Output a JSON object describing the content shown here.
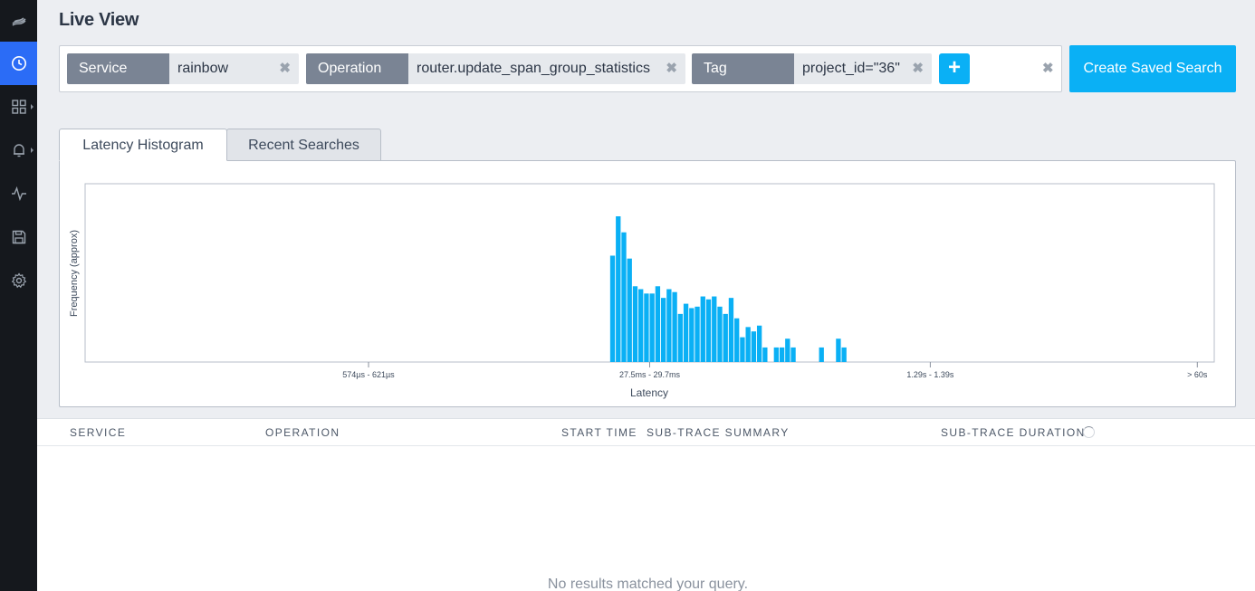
{
  "page": {
    "title": "Live View"
  },
  "sidebar": {
    "items": [
      {
        "icon": "logo-icon",
        "active": false
      },
      {
        "icon": "clock-icon",
        "active": true
      },
      {
        "icon": "dashboard-grid-icon",
        "active": false
      },
      {
        "icon": "bell-icon",
        "active": false
      },
      {
        "icon": "activity-icon",
        "active": false
      },
      {
        "icon": "save-icon",
        "active": false
      },
      {
        "icon": "gear-icon",
        "active": false
      }
    ]
  },
  "search": {
    "chips": [
      {
        "key": "Service",
        "value": "rainbow"
      },
      {
        "key": "Operation",
        "value": "router.update_span_group_statistics"
      },
      {
        "key": "Tag",
        "value": "project_id=\"36\""
      }
    ],
    "remove_symbol": "✖",
    "add_symbol": "+",
    "create_label": "Create Saved Search"
  },
  "tabs": [
    {
      "label": "Latency Histogram",
      "active": true
    },
    {
      "label": "Recent Searches",
      "active": false
    }
  ],
  "chart_data": {
    "type": "bar",
    "title": "",
    "xlabel": "Latency",
    "ylabel": "Frequency (approx)",
    "x_tick_labels": [
      "574µs - 621µs",
      "27.5ms - 29.7ms",
      "1.29s - 1.39s",
      "> 60s"
    ],
    "bar_color": "#0ab0f5",
    "grid": false,
    "bins_total": 200,
    "bars": [
      {
        "bin": 93,
        "value": 0.73
      },
      {
        "bin": 94,
        "value": 1.0
      },
      {
        "bin": 95,
        "value": 0.89
      },
      {
        "bin": 96,
        "value": 0.71
      },
      {
        "bin": 97,
        "value": 0.52
      },
      {
        "bin": 98,
        "value": 0.5
      },
      {
        "bin": 99,
        "value": 0.47
      },
      {
        "bin": 100,
        "value": 0.47
      },
      {
        "bin": 101,
        "value": 0.52
      },
      {
        "bin": 102,
        "value": 0.44
      },
      {
        "bin": 103,
        "value": 0.5
      },
      {
        "bin": 104,
        "value": 0.48
      },
      {
        "bin": 105,
        "value": 0.33
      },
      {
        "bin": 106,
        "value": 0.4
      },
      {
        "bin": 107,
        "value": 0.37
      },
      {
        "bin": 108,
        "value": 0.38
      },
      {
        "bin": 109,
        "value": 0.45
      },
      {
        "bin": 110,
        "value": 0.43
      },
      {
        "bin": 111,
        "value": 0.45
      },
      {
        "bin": 112,
        "value": 0.38
      },
      {
        "bin": 113,
        "value": 0.33
      },
      {
        "bin": 114,
        "value": 0.44
      },
      {
        "bin": 115,
        "value": 0.3
      },
      {
        "bin": 116,
        "value": 0.17
      },
      {
        "bin": 117,
        "value": 0.24
      },
      {
        "bin": 118,
        "value": 0.21
      },
      {
        "bin": 119,
        "value": 0.25
      },
      {
        "bin": 120,
        "value": 0.1
      },
      {
        "bin": 122,
        "value": 0.1
      },
      {
        "bin": 123,
        "value": 0.1
      },
      {
        "bin": 124,
        "value": 0.16
      },
      {
        "bin": 125,
        "value": 0.1
      },
      {
        "bin": 130,
        "value": 0.1
      },
      {
        "bin": 133,
        "value": 0.16
      },
      {
        "bin": 134,
        "value": 0.1
      }
    ]
  },
  "results": {
    "columns": [
      "SERVICE",
      "OPERATION",
      "START TIME",
      "SUB-TRACE SUMMARY",
      "SUB-TRACE DURATION"
    ],
    "empty_message": "No results matched your query."
  }
}
